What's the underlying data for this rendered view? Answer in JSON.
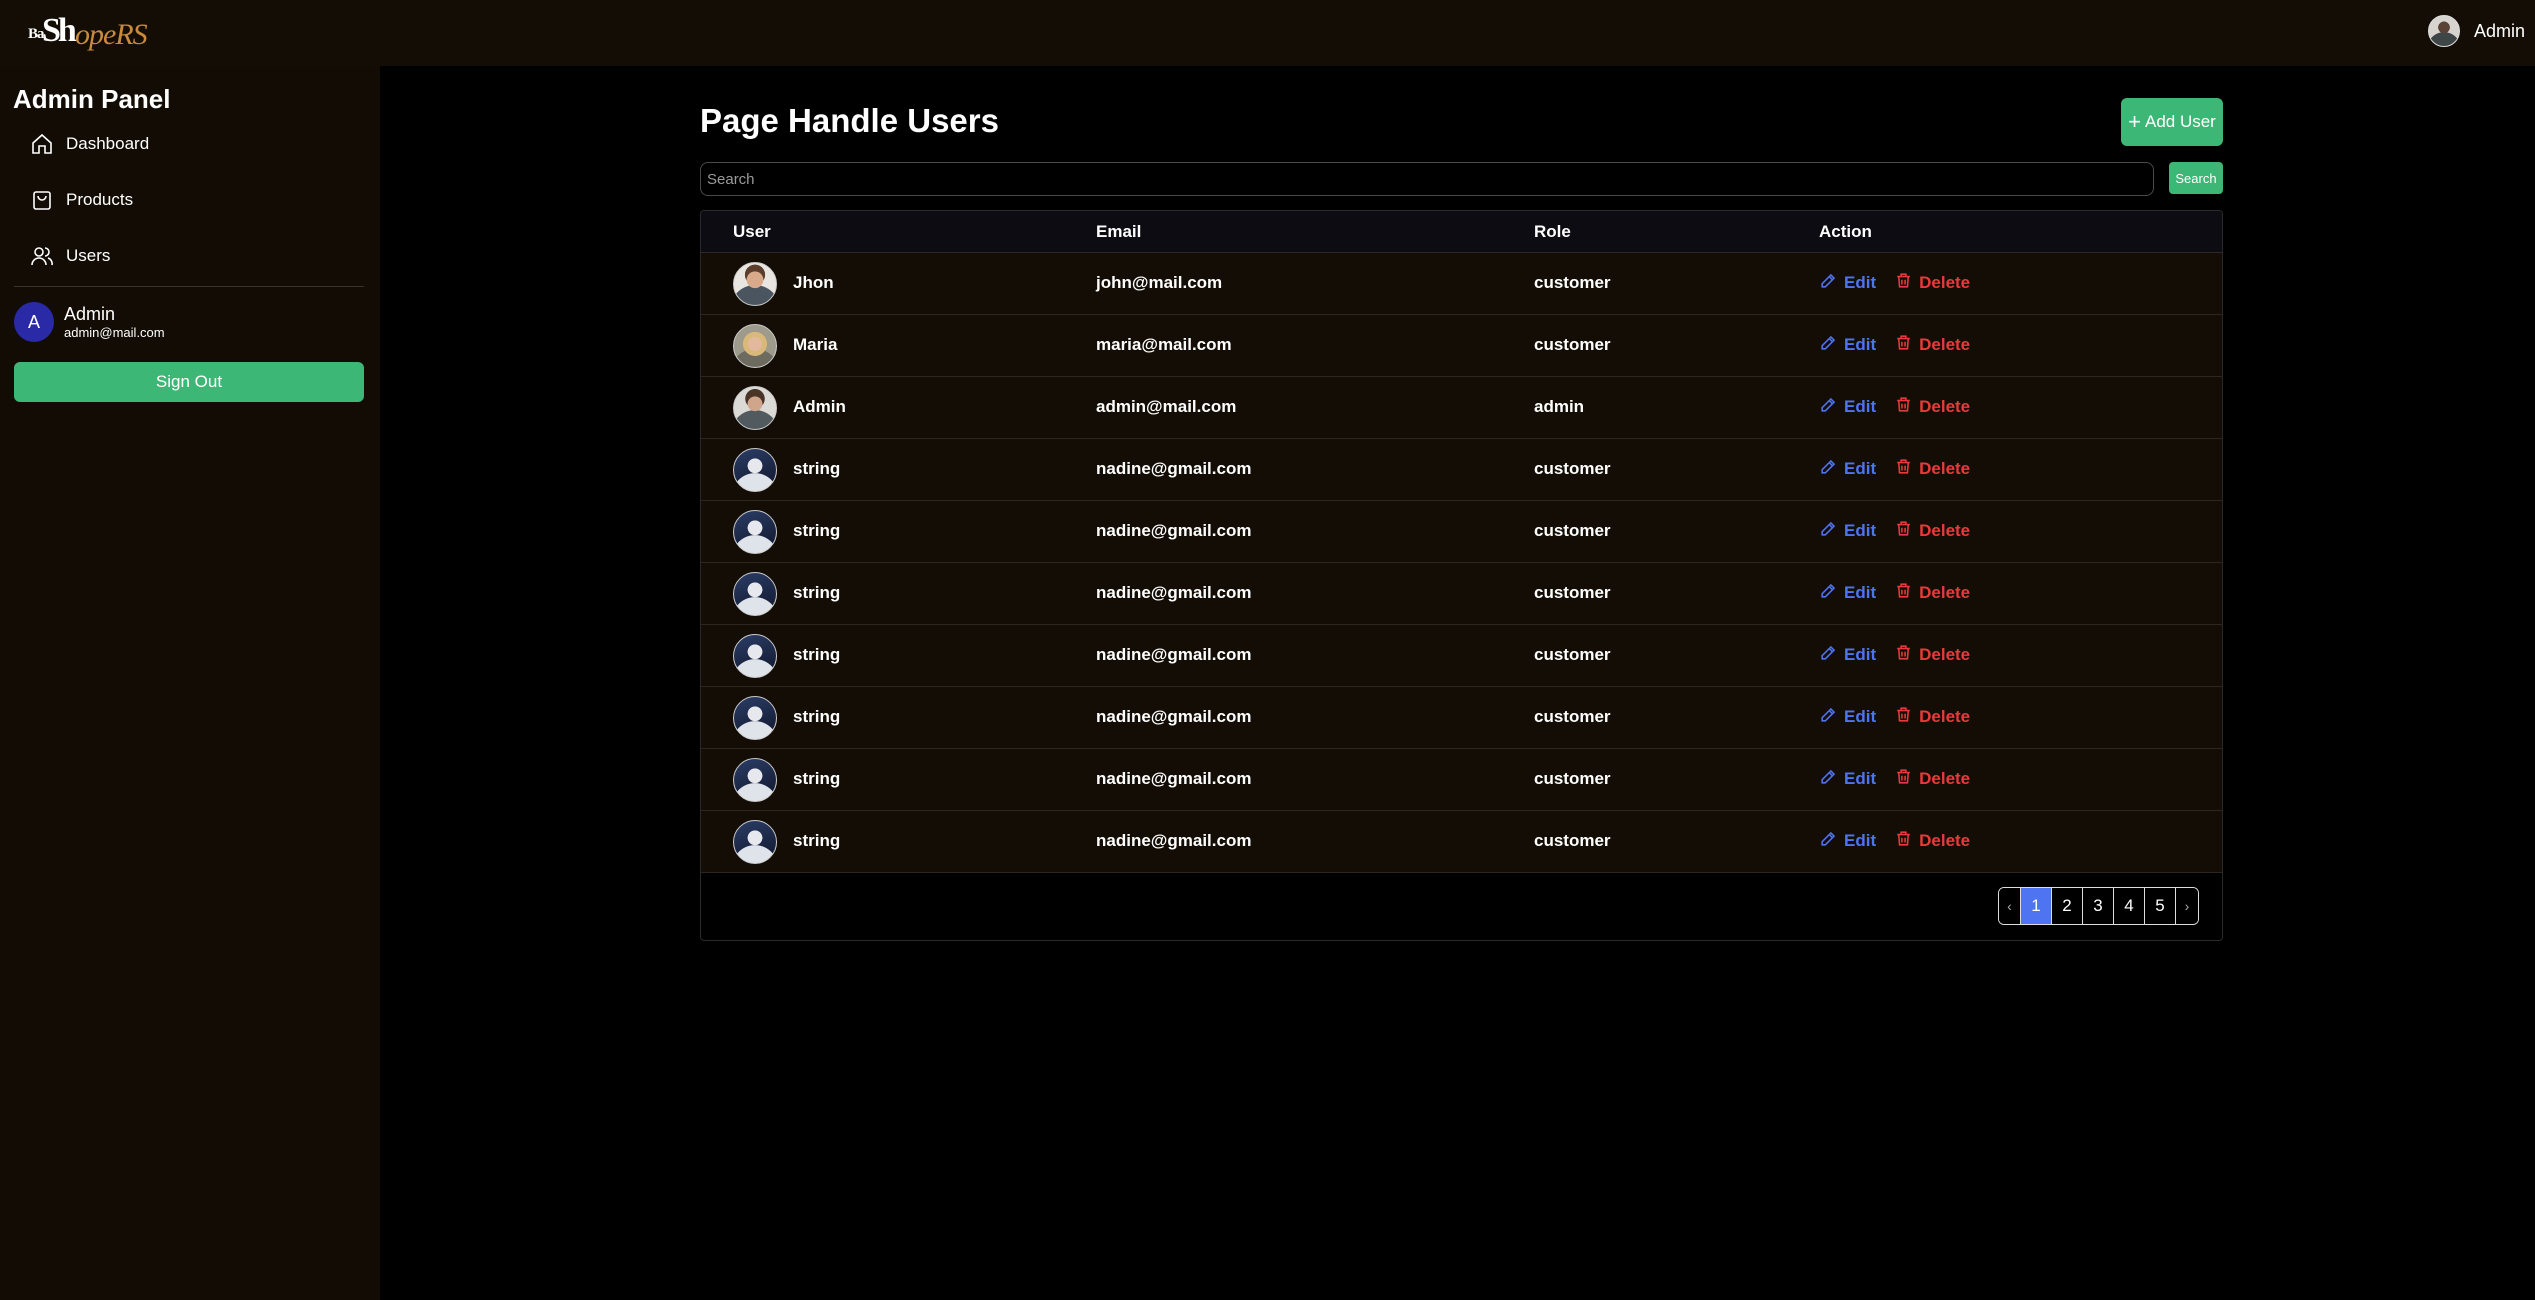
{
  "header": {
    "logo_small": "Ba",
    "logo_big": "Sh",
    "logo_tail": "opeRS",
    "user_name": "Admin"
  },
  "sidebar": {
    "title": "Admin Panel",
    "items": [
      {
        "label": "Dashboard",
        "icon": "home-icon"
      },
      {
        "label": "Products",
        "icon": "shopping-bag-icon"
      },
      {
        "label": "Users",
        "icon": "users-icon"
      }
    ],
    "user": {
      "initial": "A",
      "name": "Admin",
      "email": "admin@mail.com"
    },
    "signout_label": "Sign Out"
  },
  "main": {
    "title": "Page Handle Users",
    "add_button_label": "Add User",
    "search_placeholder": "Search",
    "search_button_label": "Search",
    "columns": [
      "User",
      "Email",
      "Role",
      "Action"
    ],
    "edit_label": "Edit",
    "delete_label": "Delete",
    "rows": [
      {
        "name": "Jhon",
        "email": "john@mail.com",
        "role": "customer",
        "avatar": "man"
      },
      {
        "name": "Maria",
        "email": "maria@mail.com",
        "role": "customer",
        "avatar": "woman"
      },
      {
        "name": "Admin",
        "email": "admin@mail.com",
        "role": "admin",
        "avatar": "admin"
      },
      {
        "name": "string",
        "email": "nadine@gmail.com",
        "role": "customer",
        "avatar": "string"
      },
      {
        "name": "string",
        "email": "nadine@gmail.com",
        "role": "customer",
        "avatar": "string"
      },
      {
        "name": "string",
        "email": "nadine@gmail.com",
        "role": "customer",
        "avatar": "string"
      },
      {
        "name": "string",
        "email": "nadine@gmail.com",
        "role": "customer",
        "avatar": "string"
      },
      {
        "name": "string",
        "email": "nadine@gmail.com",
        "role": "customer",
        "avatar": "string"
      },
      {
        "name": "string",
        "email": "nadine@gmail.com",
        "role": "customer",
        "avatar": "string"
      },
      {
        "name": "string",
        "email": "nadine@gmail.com",
        "role": "customer",
        "avatar": "string"
      }
    ],
    "pagination": {
      "prev": "‹",
      "pages": [
        "1",
        "2",
        "3",
        "4",
        "5"
      ],
      "current": "1",
      "next": "›"
    }
  },
  "colors": {
    "accent_green": "#3cb775",
    "edit_blue": "#4f74f2",
    "delete_red": "#e83a3a",
    "panel_brown": "#140d05"
  }
}
